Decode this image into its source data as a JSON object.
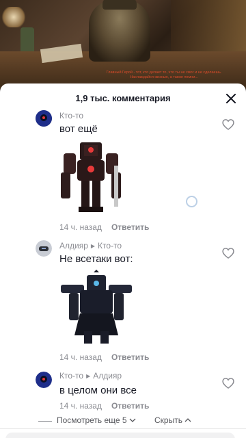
{
  "video": {
    "caption": "Главный Герой - тот, кто делает то, что ты не смог и не сделаешь. Наслаждайся жизнью, а также помни..."
  },
  "sheet": {
    "title": "1,9 тыс. комментария",
    "close_icon": "close-icon"
  },
  "comments": [
    {
      "username": "Кто-то",
      "reply_to": "",
      "text": "вот ещё",
      "time": "14 ч. назад",
      "reply_label": "Ответить",
      "has_image": true
    },
    {
      "username": "Алдияр",
      "reply_to": "Кто-то",
      "text": "Не всетаки вот:",
      "time": "14 ч. назад",
      "reply_label": "Ответить",
      "has_image": true
    },
    {
      "username": "Кто-то",
      "reply_to": "Алдияр",
      "text": "в целом они все",
      "time": "14 ч. назад",
      "reply_label": "Ответить",
      "has_image": false
    }
  ],
  "footer": {
    "more_label": "Посмотреть еще 5",
    "hide_label": "Скрыть"
  },
  "colors": {
    "text_primary": "#161823",
    "text_secondary": "#8a8b91"
  }
}
